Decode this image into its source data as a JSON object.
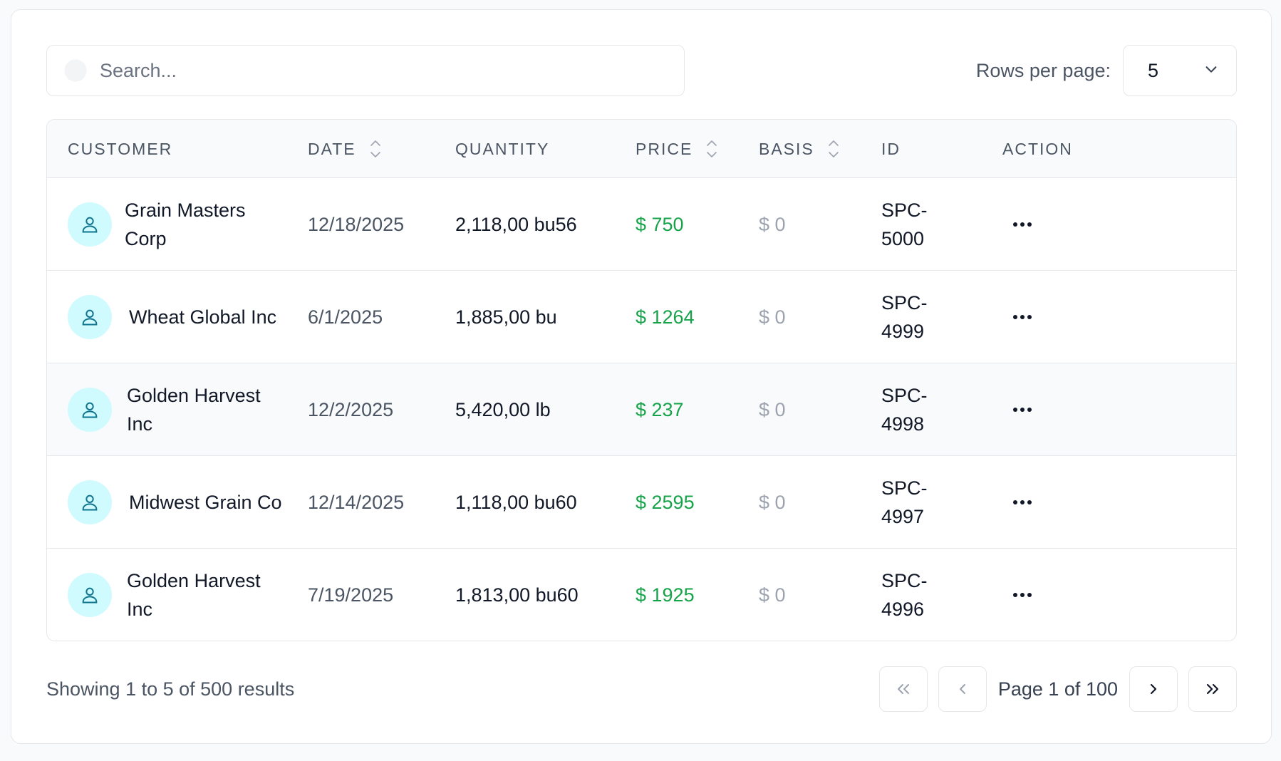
{
  "search": {
    "placeholder": "Search..."
  },
  "rows_per_page": {
    "label": "Rows per page:",
    "value": "5"
  },
  "columns": {
    "customer": "CUSTOMER",
    "date": "DATE",
    "quantity": "QUANTITY",
    "price": "PRICE",
    "basis": "BASIS",
    "id": "ID",
    "action": "ACTION"
  },
  "rows": [
    {
      "customer": "Grain Masters Corp",
      "date": "12/18/2025",
      "quantity": "2,118,00 bu56",
      "price": "$ 750",
      "basis": "$ 0",
      "id": "SPC-5000"
    },
    {
      "customer": "Wheat Global Inc",
      "date": "6/1/2025",
      "quantity": "1,885,00 bu",
      "price": "$ 1264",
      "basis": "$ 0",
      "id": "SPC-4999"
    },
    {
      "customer": "Golden Harvest Inc",
      "date": "12/2/2025",
      "quantity": "5,420,00 lb",
      "price": "$ 237",
      "basis": "$ 0",
      "id": "SPC-4998"
    },
    {
      "customer": "Midwest Grain Co",
      "date": "12/14/2025",
      "quantity": "1,118,00 bu60",
      "price": "$ 2595",
      "basis": "$ 0",
      "id": "SPC-4997"
    },
    {
      "customer": "Golden Harvest Inc",
      "date": "7/19/2025",
      "quantity": "1,813,00 bu60",
      "price": "$ 1925",
      "basis": "$ 0",
      "id": "SPC-4996"
    }
  ],
  "footer": {
    "showing": "Showing 1 to 5 of 500 results",
    "page_info": "Page 1 of 100"
  },
  "colors": {
    "price": "#16a34a",
    "basis": "#9ca3af",
    "avatar_bg": "#cffafe",
    "avatar_icon": "#0e7490"
  },
  "icons": {
    "search": "search-icon",
    "dropdown": "chevron-down-icon",
    "sort": "sort-icon",
    "avatar": "user-icon",
    "action": "more-horizontal-icon",
    "first": "chevrons-left-icon",
    "prev": "chevron-left-icon",
    "next": "chevron-right-icon",
    "last": "chevrons-right-icon"
  }
}
